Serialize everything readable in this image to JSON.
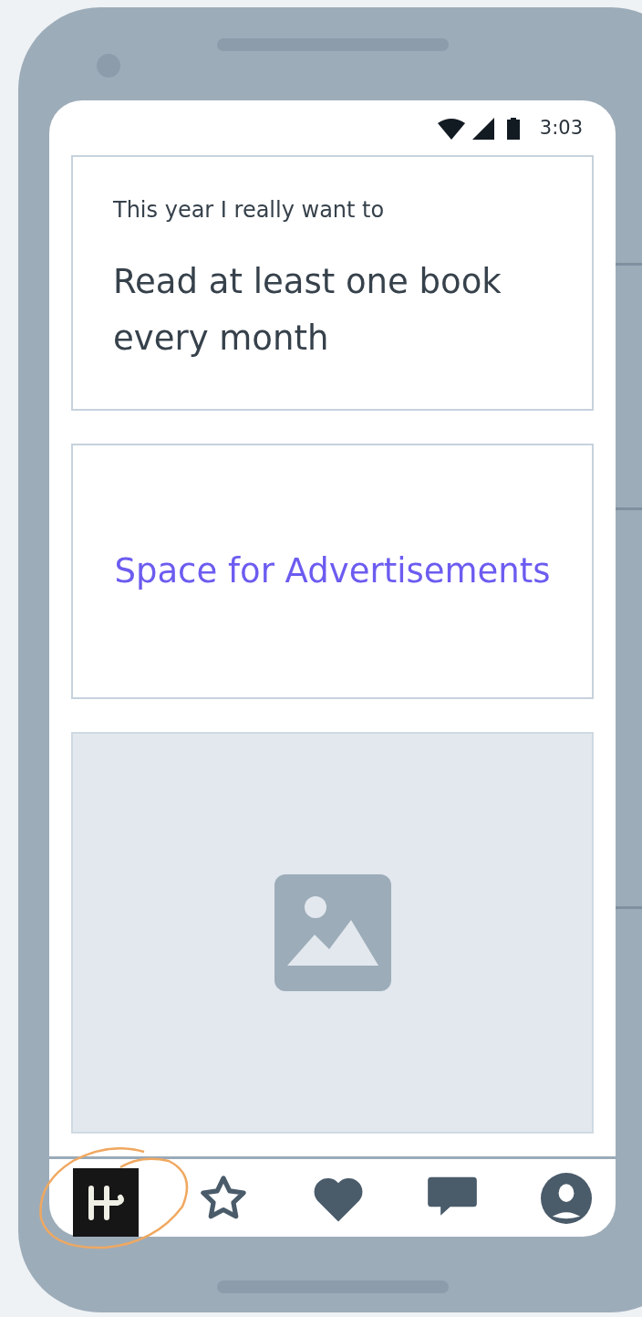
{
  "status_bar": {
    "time": "3:03"
  },
  "goal_card": {
    "label": "This year I really want to",
    "goal": "Read at least one book every month"
  },
  "ad_card": {
    "text": "Space for Advertisements"
  },
  "bottom_nav": {
    "items": [
      {
        "kind": "logo",
        "annotated": true
      },
      {
        "kind": "star",
        "annotated": false
      },
      {
        "kind": "heart",
        "annotated": false
      },
      {
        "kind": "chat",
        "annotated": false
      },
      {
        "kind": "profile",
        "annotated": false
      }
    ]
  }
}
